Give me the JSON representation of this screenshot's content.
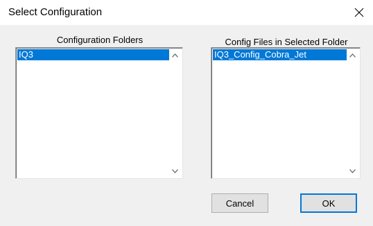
{
  "window": {
    "title": "Select Configuration"
  },
  "folders": {
    "label": "Configuration Folders",
    "items": [
      {
        "label": "IQ3",
        "selected": true
      }
    ]
  },
  "files": {
    "label": "Config Files in Selected Folder",
    "items": [
      {
        "label": "IQ3_Config_Cobra_Jet",
        "selected": true
      }
    ]
  },
  "buttons": {
    "cancel": "Cancel",
    "ok": "OK"
  },
  "icons": {
    "close": "close-icon",
    "scroll_up": "chevron-up-icon",
    "scroll_down": "chevron-down-icon"
  },
  "colors": {
    "selection": "#0078d7",
    "dialog_bg": "#f0f0f0"
  }
}
